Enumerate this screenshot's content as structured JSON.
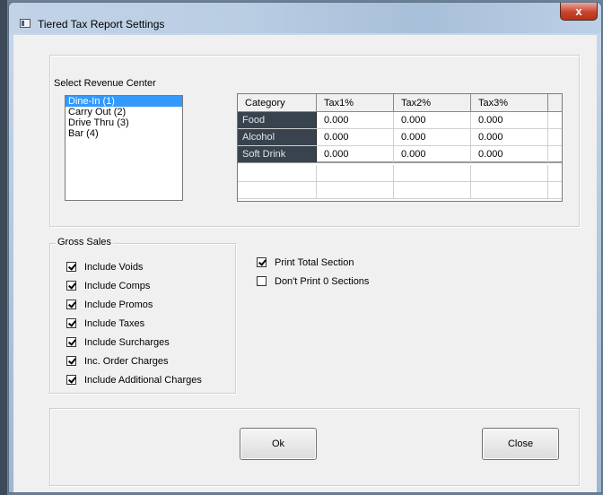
{
  "window": {
    "title": "Tiered Tax Report Settings",
    "close_glyph": "x"
  },
  "revenue_center": {
    "label": "Select Revenue Center",
    "items": [
      "Dine-In (1)",
      "Carry Out (2)",
      "Drive Thru (3)",
      "Bar (4)"
    ],
    "selected_index": 0
  },
  "tax_grid": {
    "columns": [
      "Category",
      "Tax1%",
      "Tax2%",
      "Tax3%"
    ],
    "rows": [
      [
        "Food",
        "0.000",
        "0.000",
        "0.000"
      ],
      [
        "Alcohol",
        "0.000",
        "0.000",
        "0.000"
      ],
      [
        "Soft Drink",
        "0.000",
        "0.000",
        "0.000"
      ]
    ]
  },
  "gross_sales": {
    "legend": "Gross Sales",
    "options": [
      {
        "label": "Include Voids",
        "checked": true
      },
      {
        "label": "Include Comps",
        "checked": true
      },
      {
        "label": "Include Promos",
        "checked": true
      },
      {
        "label": "Include Taxes",
        "checked": true
      },
      {
        "label": "Include Surcharges",
        "checked": true
      },
      {
        "label": "Inc. Order Charges",
        "checked": true
      },
      {
        "label": "Include Additional Charges",
        "checked": true
      }
    ]
  },
  "print_options": [
    {
      "label": "Print Total Section",
      "checked": true
    },
    {
      "label": "Don't Print 0 Sections",
      "checked": false
    }
  ],
  "buttons": {
    "ok": "Ok",
    "close": "Close"
  }
}
